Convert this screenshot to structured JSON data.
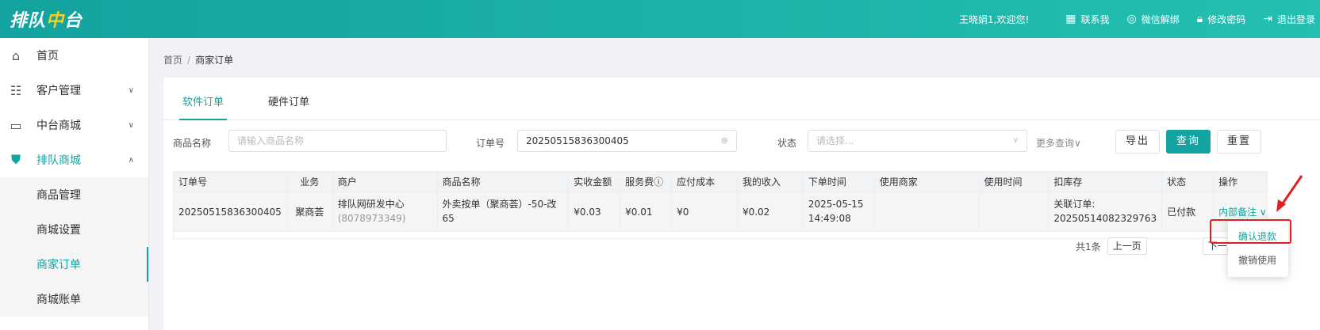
{
  "header": {
    "logo_part1": "排队",
    "logo_part2": "中",
    "logo_part3": "台",
    "welcome": "王晓娟1,欢迎您!",
    "links": [
      {
        "label": "联系我",
        "icon": "grid-icon"
      },
      {
        "label": "微信解绑",
        "icon": "wechat-icon"
      },
      {
        "label": "修改密码",
        "icon": "lock-icon"
      },
      {
        "label": "退出登录",
        "icon": "logout-icon"
      }
    ]
  },
  "sidebar": {
    "items": [
      {
        "label": "首页",
        "icon": "home-icon"
      },
      {
        "label": "客户管理",
        "icon": "customer-icon"
      },
      {
        "label": "中台商城",
        "icon": "store-icon"
      },
      {
        "label": "排队商城",
        "icon": "shield-icon"
      }
    ],
    "subitems": [
      "商品管理",
      "商城设置",
      "商家订单",
      "商城账单"
    ]
  },
  "breadcrumb": {
    "home": "首页",
    "sep": "/",
    "current": "商家订单"
  },
  "tabs": [
    "软件订单",
    "硬件订单"
  ],
  "filters": {
    "product_label": "商品名称",
    "product_placeholder": "请输入商品名称",
    "order_label": "订单号",
    "order_value": "20250515836300405",
    "status_label": "状态",
    "status_placeholder": "请选择...",
    "more": "更多查询∨",
    "export": "导出",
    "query": "查询",
    "reset": "重置"
  },
  "table": {
    "headers": [
      "订单号",
      "业务",
      "商户",
      "商品名称",
      "实收金额",
      "服务费",
      "应付成本",
      "我的收入",
      "下单时间",
      "使用商家",
      "使用时间",
      "扣库存",
      "状态",
      "操作"
    ],
    "row": {
      "order_no": "20250515836300405",
      "business": "聚商荟",
      "merchant": "排队网研发中心",
      "merchant_id": "(8078973349)",
      "product": "外卖按单（聚商荟）-50-改65",
      "received": "¥0.03",
      "fee": "¥0.01",
      "cost": "¥0",
      "income": "¥0.02",
      "order_date": "2025-05-15",
      "order_time": "14:49:08",
      "use_merchant": "",
      "use_time": "",
      "stock_label": "关联订单:",
      "stock_value": "20250514082329763",
      "status": "已付款",
      "action": "内部备注"
    }
  },
  "pager": {
    "total": "共1条",
    "prev": "上一页",
    "next": "下一页"
  },
  "popup": {
    "confirm_refund": "确认退款",
    "cancel_use": "撤销使用"
  },
  "colors": {
    "primary": "#13a3a0",
    "highlight": "#e02020"
  }
}
